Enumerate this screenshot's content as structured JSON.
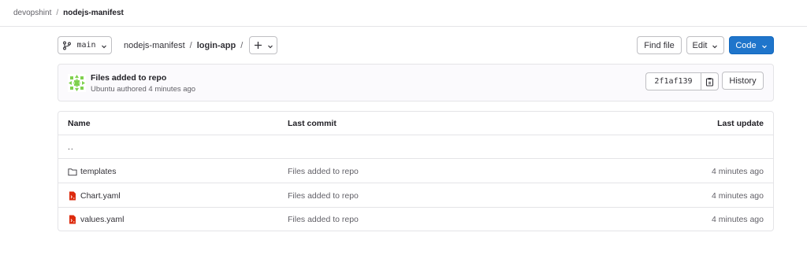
{
  "breadcrumb": {
    "group": "devopshint",
    "project": "nodejs-manifest"
  },
  "toolbar": {
    "branch": "main",
    "path": [
      "nodejs-manifest",
      "login-app"
    ],
    "path_separator": "/",
    "find_file": "Find file",
    "edit": "Edit",
    "code": "Code"
  },
  "commit": {
    "title": "Files added to repo",
    "meta": "Ubuntu authored 4 minutes ago",
    "sha": "2f1af139",
    "history": "History"
  },
  "table": {
    "headers": {
      "name": "Name",
      "last_commit": "Last commit",
      "last_update": "Last update"
    },
    "parent": "..",
    "rows": [
      {
        "name": "templates",
        "type": "folder",
        "commit": "Files added to repo",
        "updated": "4 minutes ago"
      },
      {
        "name": "Chart.yaml",
        "type": "yaml-file",
        "commit": "Files added to repo",
        "updated": "4 minutes ago"
      },
      {
        "name": "values.yaml",
        "type": "yaml-file",
        "commit": "Files added to repo",
        "updated": "4 minutes ago"
      }
    ]
  },
  "colors": {
    "primary": "#1f75cb",
    "file_icon": "#dd2b0e",
    "avatar": "#7fd14e"
  }
}
